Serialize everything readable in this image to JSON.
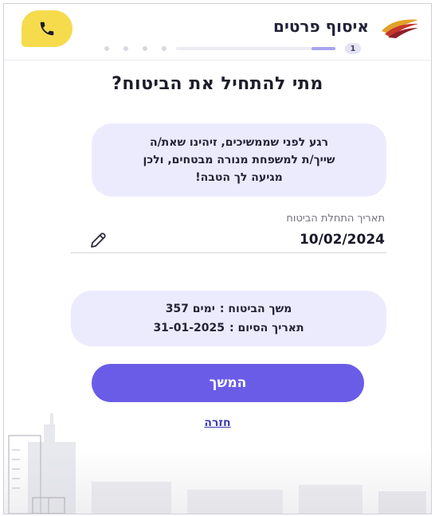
{
  "header": {
    "title": "איסוף פרטים",
    "step_number": "1",
    "progress_fraction": 0.15,
    "brand_color": "#e0a22a",
    "phone_button_color": "#f6db4c"
  },
  "main": {
    "title": "מתי להתחיל את הביטוח?",
    "info_lines": [
      "רגע לפני שממשיכים, זיהינו שאת/ה",
      "שייך/ת למשפחת מנורה מבטחים, ולכן",
      "מגיעה לך הטבה!"
    ],
    "date_field": {
      "label": "תאריך התחלת הביטוח",
      "value": "10/02/2024"
    },
    "summary": {
      "duration_label": "משך הביטוח :",
      "duration_value": "357 ימים",
      "end_label": "תאריך הסיום :",
      "end_value": "31-01-2025"
    },
    "continue_label": "המשך",
    "back_label": "חזרה"
  },
  "icons": {
    "phone": "phone-icon",
    "edit": "pencil-icon",
    "logo": "brand-logo"
  },
  "colors": {
    "accent": "#6b5ce7",
    "card_bg": "#ecebfd",
    "link": "#3a3ab0"
  }
}
